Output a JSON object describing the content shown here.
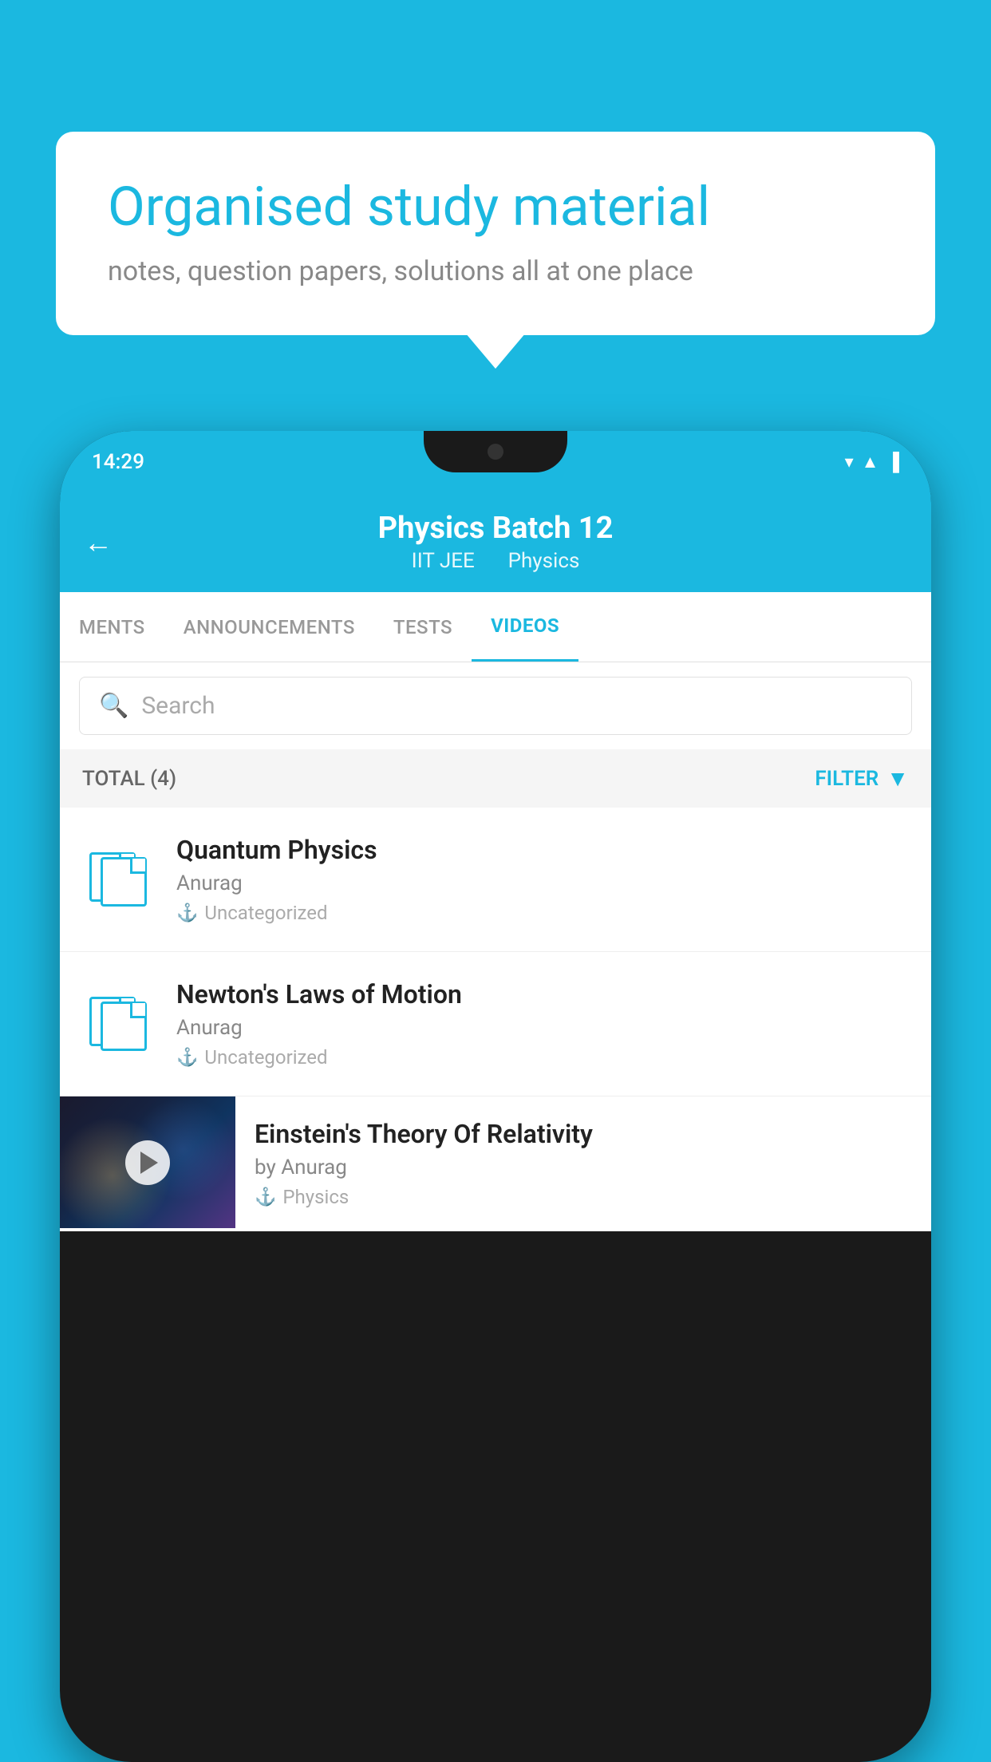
{
  "background_color": "#1BB8E0",
  "speech_bubble": {
    "title": "Organised study material",
    "subtitle": "notes, question papers, solutions all at one place"
  },
  "phone": {
    "status_bar": {
      "time": "14:29"
    },
    "app_header": {
      "back_label": "←",
      "title": "Physics Batch 12",
      "subtitle_part1": "IIT JEE",
      "subtitle_part2": "Physics"
    },
    "tabs": [
      {
        "label": "MENTS",
        "active": false
      },
      {
        "label": "ANNOUNCEMENTS",
        "active": false
      },
      {
        "label": "TESTS",
        "active": false
      },
      {
        "label": "VIDEOS",
        "active": true
      }
    ],
    "search": {
      "placeholder": "Search"
    },
    "filter_bar": {
      "total_label": "TOTAL (4)",
      "filter_label": "FILTER"
    },
    "videos": [
      {
        "id": 1,
        "title": "Quantum Physics",
        "author": "Anurag",
        "tag": "Uncategorized",
        "has_thumbnail": false
      },
      {
        "id": 2,
        "title": "Newton's Laws of Motion",
        "author": "Anurag",
        "tag": "Uncategorized",
        "has_thumbnail": false
      },
      {
        "id": 3,
        "title": "Einstein's Theory Of Relativity",
        "author": "by Anurag",
        "tag": "Physics",
        "has_thumbnail": true
      }
    ]
  }
}
